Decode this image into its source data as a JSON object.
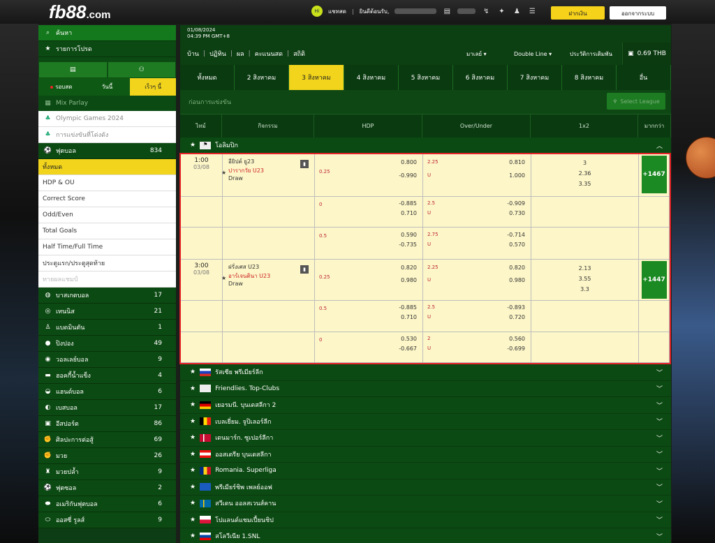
{
  "header": {
    "logo": "fb88",
    "logo_suffix": ".com",
    "chat": "แชทสด",
    "welcome": "ยินดีต้อนรับ,",
    "deposit": "ฝากเงิน",
    "logout": "ออกจากระบบ"
  },
  "sidebar": {
    "search": "ค้นหา",
    "favorites": "รายการโปรด",
    "live_tab": "รอบสด",
    "today_tab": "วันนี้",
    "soon_tab": "เร็วๆ นี้",
    "mix_parlay": "Mix Parlay",
    "special": [
      {
        "label": "Olympic Games 2024"
      },
      {
        "label": "การแข่งขันที่โด่งดัง"
      }
    ],
    "football": {
      "label": "ฟุตบอล",
      "count": "834"
    },
    "sub": [
      {
        "label": "ทั้งหมด",
        "active": true
      },
      {
        "label": "HDP & OU"
      },
      {
        "label": "Correct Score"
      },
      {
        "label": "Odd/Even"
      },
      {
        "label": "Total Goals"
      },
      {
        "label": "Half Time/Full Time"
      },
      {
        "label": "ประตูแรก/ประตูสุดท้าย"
      },
      {
        "label": "ทายผลแชมป์",
        "dim": true
      }
    ],
    "sports": [
      {
        "label": "บาสเกตบอล",
        "count": "17",
        "icon": "basketball-icon"
      },
      {
        "label": "เทนนิส",
        "count": "21",
        "icon": "tennis-icon"
      },
      {
        "label": "แบดมินตัน",
        "count": "1",
        "icon": "badminton-icon"
      },
      {
        "label": "ปิงปอง",
        "count": "49",
        "icon": "pingpong-icon"
      },
      {
        "label": "วอลเลย์บอล",
        "count": "9",
        "icon": "volleyball-icon"
      },
      {
        "label": "ฮอคกี้น้ำแข็ง",
        "count": "4",
        "icon": "hockey-icon"
      },
      {
        "label": "แฮนด์บอล",
        "count": "6",
        "icon": "handball-icon"
      },
      {
        "label": "เบสบอล",
        "count": "17",
        "icon": "baseball-icon"
      },
      {
        "label": "อีสปอร์ต",
        "count": "86",
        "icon": "esports-icon"
      },
      {
        "label": "ศิลปะการต่อสู้",
        "count": "69",
        "icon": "martial-arts-icon"
      },
      {
        "label": "มวย",
        "count": "26",
        "icon": "boxing-icon"
      },
      {
        "label": "มวยปล้ำ",
        "count": "9",
        "icon": "wrestling-icon"
      },
      {
        "label": "ฟุตซอล",
        "count": "2",
        "icon": "futsal-icon"
      },
      {
        "label": "อเมริกันฟุตบอล",
        "count": "6",
        "icon": "american-football-icon"
      },
      {
        "label": "ออสซี่ รูลส์",
        "count": "9",
        "icon": "aussie-rules-icon"
      }
    ]
  },
  "main": {
    "date": "01/08/2024",
    "time": "04:39 PM GMT+8",
    "nav": [
      "บ้าน",
      "ปฏิทิน",
      "ผล",
      "คะแนนสด",
      "สถิติ"
    ],
    "odds_type": "มาเลย์",
    "line_type": "Double Line",
    "history": "ประวัติการเดิมพัน",
    "balance": "0.69 THB",
    "date_tabs": [
      {
        "label": "ทั้งหมด"
      },
      {
        "label": "2 สิงหาคม"
      },
      {
        "label": "3 สิงหาคม",
        "active": true
      },
      {
        "label": "4 สิงหาคม"
      },
      {
        "label": "5 สิงหาคม"
      },
      {
        "label": "6 สิงหาคม"
      },
      {
        "label": "7 สิงหาคม"
      },
      {
        "label": "8 สิงหาคม"
      },
      {
        "label": "อื่น"
      }
    ],
    "prematch": "ก่อนการแข่งขัน",
    "select_league": "Select League",
    "columns": [
      "ไทม์",
      "กิจกรรม",
      "HDP",
      "Over/Under",
      "1x2",
      "มากกว่า"
    ],
    "open_league": "โอลิมปิก",
    "matches": [
      {
        "time": "1:00",
        "date": "03/08",
        "home": "อียิปต์ ยู23",
        "away": "ปารากวัย U23",
        "draw": "Draw",
        "more": "+1467",
        "rows": [
          {
            "hdp_line": "0.25",
            "hdp_h": "0.800",
            "hdp_a": "-0.990",
            "ou_line": "2.25",
            "ou_u": "U",
            "ou_o": "0.810",
            "ou_u_odds": "1.000",
            "x1": "3",
            "x2": "2.36",
            "x3": "3.35"
          },
          {
            "hdp_line": "0",
            "hdp_h": "-0.885",
            "hdp_a": "0.710",
            "ou_line": "2.5",
            "ou_u": "U",
            "ou_o": "-0.909",
            "ou_u_odds": "0.730"
          },
          {
            "hdp_line": "0.5",
            "hdp_h": "0.590",
            "hdp_a": "-0.735",
            "ou_line": "2.75",
            "ou_u": "U",
            "ou_o": "-0.714",
            "ou_u_odds": "0.570"
          }
        ]
      },
      {
        "time": "3:00",
        "date": "03/08",
        "home": "ฝรั่งเศส U23",
        "away": "อาร์เจนตินา U23",
        "draw": "Draw",
        "more": "+1447",
        "rows": [
          {
            "hdp_line": "0.25",
            "hdp_h": "0.820",
            "hdp_a": "0.980",
            "ou_line": "2.25",
            "ou_u": "U",
            "ou_o": "0.820",
            "ou_u_odds": "0.980",
            "x1": "2.13",
            "x2": "3.55",
            "x3": "3.3"
          },
          {
            "hdp_line": "0.5",
            "hdp_h": "-0.885",
            "hdp_a": "0.710",
            "ou_line": "2.5",
            "ou_u": "U",
            "ou_o": "-0.893",
            "ou_u_odds": "0.720"
          },
          {
            "hdp_line": "0",
            "hdp_h": "0.530",
            "hdp_a": "-0.667",
            "ou_line": "2",
            "ou_u": "U",
            "ou_o": "0.560",
            "ou_u_odds": "-0.699"
          }
        ]
      }
    ],
    "leagues": [
      {
        "label": "รัสเซีย พรีเมียร์ลีก",
        "flag": "russia"
      },
      {
        "label": "Friendlies. Top-Clubs",
        "flag": "world"
      },
      {
        "label": "เยอรมนี. บุนเดสลีกา 2",
        "flag": "germany"
      },
      {
        "label": "เบลเยี่ยม. จูปิเลอร์ลีก",
        "flag": "belgium"
      },
      {
        "label": "เดนมาร์ก. ซูเปอร์ลีกา",
        "flag": "denmark"
      },
      {
        "label": "ออสเตรีย บุนเดสลีกา",
        "flag": "austria"
      },
      {
        "label": "Romania. Superliga",
        "flag": "romania"
      },
      {
        "label": "พรีเมียร์ชิพ เพลย์ออฟ",
        "flag": "scotland"
      },
      {
        "label": "สวีเดน ออลสเวนส์คาน",
        "flag": "sweden"
      },
      {
        "label": "โปแลนด์แชมเปี้ยนชิป",
        "flag": "poland"
      },
      {
        "label": "สโลวีเนีย 1.SNL",
        "flag": "slovenia"
      }
    ]
  }
}
